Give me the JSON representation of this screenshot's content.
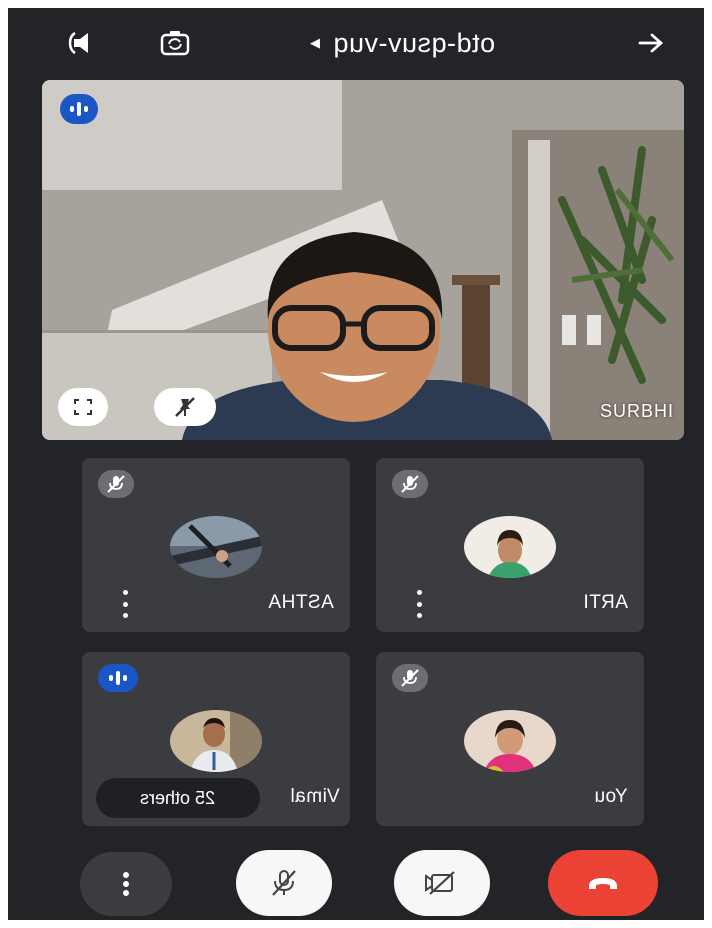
{
  "topbar": {
    "meeting_code": "otd-qsuv-vuq",
    "icons": [
      "speaker-icon",
      "switch-camera-icon",
      "arrow-icon"
    ]
  },
  "main_tile": {
    "name": "SURBHI",
    "speaking": true
  },
  "tiles": [
    {
      "name": "ASTHA",
      "muted": true
    },
    {
      "name": "ARTI",
      "muted": true
    },
    {
      "name": "Vimal",
      "speaking": true,
      "others_label": "25 others"
    },
    {
      "name": "You",
      "muted": true
    }
  ],
  "controls": [
    "more-options-icon",
    "mic-off-icon",
    "camera-off-icon",
    "end-call-icon"
  ],
  "colors": {
    "background": "#232427",
    "tile": "#3b3c3f",
    "speaking_blue": "#1a56c6",
    "end_call_red": "#ea4335"
  }
}
